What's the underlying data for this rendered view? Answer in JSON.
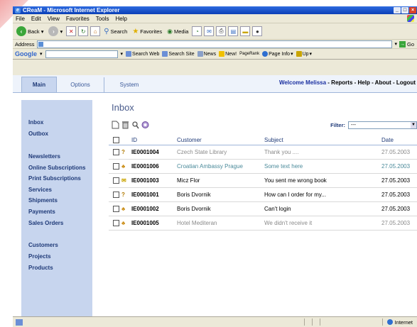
{
  "window": {
    "title": "CReaM - Microsoft Internet Explorer"
  },
  "menu": {
    "items": [
      "File",
      "Edit",
      "View",
      "Favorites",
      "Tools",
      "Help"
    ]
  },
  "toolbar": {
    "back": "Back",
    "search": "Search",
    "favorites": "Favorites",
    "media": "Media"
  },
  "address": {
    "label": "Address",
    "go": "Go"
  },
  "google": {
    "logo": "Google",
    "search_web": "Search Web",
    "search_site": "Search Site",
    "news": "News",
    "new": "New!",
    "pagerank": "PageRank",
    "page_info": "Page Info",
    "up": "Up"
  },
  "app": {
    "tabs": [
      "Main",
      "Options",
      "System"
    ],
    "welcome": "Welcome Melissa",
    "links": [
      "Reports",
      "Help",
      "About",
      "Logout"
    ],
    "sidebar": {
      "group1": [
        "Inbox",
        "Outbox"
      ],
      "group2": [
        "Newsletters",
        "Online Subscriptions",
        "Print Subscriptions",
        "Services",
        "Shipments",
        "Payments",
        "Sales Orders"
      ],
      "group3": [
        "Customers",
        "Projects",
        "Products"
      ]
    },
    "inbox": {
      "title": "Inbox",
      "filter_label": "Filter:",
      "filter_value": "---",
      "columns": [
        "ID",
        "Customer",
        "Subject",
        "Date"
      ],
      "rows": [
        {
          "id": "IE0001004",
          "customer": "Czech State Library",
          "subject": "Thank you ....",
          "date": "27.05.2003",
          "icon": "question-icon",
          "style": "muted"
        },
        {
          "id": "IE0001006",
          "customer": "Croatian Ambassy Prague",
          "subject": "Some text here",
          "date": "27.05.2003",
          "icon": "people-icon",
          "style": "link"
        },
        {
          "id": "IE0001003",
          "customer": "Micz Flor",
          "subject": "You sent me wrong book",
          "date": "27.05.2003",
          "icon": "envelope-icon",
          "style": "normal"
        },
        {
          "id": "IE0001001",
          "customer": "Boris Dvornik",
          "subject": "How can I order for my...",
          "date": "27.05.2003",
          "icon": "question-icon",
          "style": "normal"
        },
        {
          "id": "IE0001002",
          "customer": "Boris Dvornik",
          "subject": "Can't login",
          "date": "27.05.2003",
          "icon": "people-icon",
          "style": "normal"
        },
        {
          "id": "IE0001005",
          "customer": "Hotel Mediteran",
          "subject": "We didn't receive it",
          "date": "27.05.2003",
          "icon": "people-icon",
          "style": "muted"
        }
      ]
    }
  },
  "status": {
    "zone": "Internet"
  },
  "colors": {
    "sidebar": "#c7d5ee",
    "title_blue": "#0a3fb6",
    "link_teal": "#4a8a9a"
  }
}
